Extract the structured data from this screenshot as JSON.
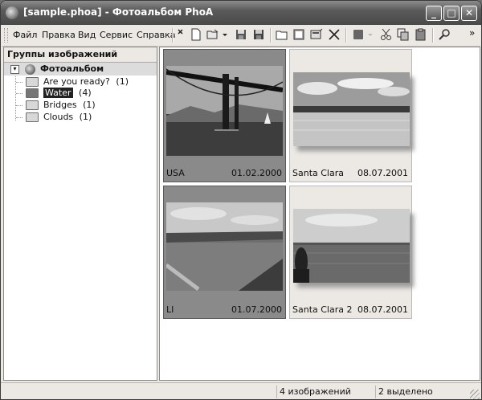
{
  "window": {
    "title": "[sample.phoa] - Фотоальбом PhoA"
  },
  "title_buttons": {
    "minimize": "_",
    "maximize": "□",
    "close": "✕"
  },
  "menu": [
    "Файл",
    "Правка",
    "Вид",
    "Сервис",
    "Справка"
  ],
  "toolbar_overflow": "»",
  "left": {
    "header": "Группы изображений",
    "root": "Фотоальбом",
    "items": [
      {
        "label": "Are you ready?",
        "count": "(1)"
      },
      {
        "label": "Water",
        "count": "(4)"
      },
      {
        "label": "Bridges",
        "count": "(1)"
      },
      {
        "label": "Clouds",
        "count": "(1)"
      }
    ]
  },
  "thumbnails": [
    {
      "name": "USA",
      "date": "01.02.2000"
    },
    {
      "name": "Santa Clara",
      "date": "08.07.2001"
    },
    {
      "name": "LI",
      "date": "01.07.2000"
    },
    {
      "name": "Santa Clara 2",
      "date": "08.07.2001"
    }
  ],
  "status": {
    "count": "4 изображений",
    "selected": "2 выделено"
  }
}
